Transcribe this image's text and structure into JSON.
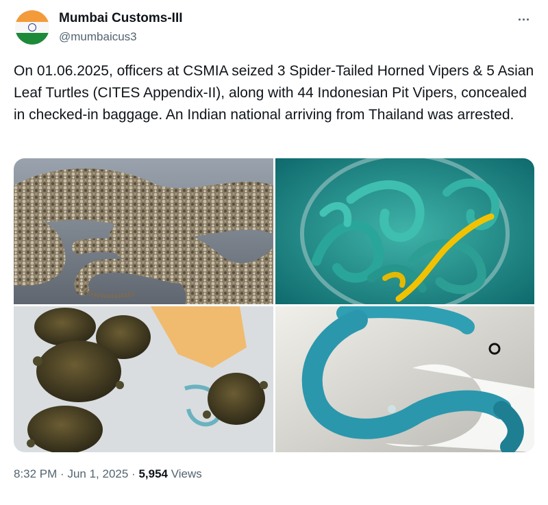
{
  "author": {
    "name": "Mumbai Customs-III",
    "handle": "@mumbaicus3",
    "avatar_icon": "india-flag-avatar"
  },
  "menu": {
    "icon": "more-options-icon"
  },
  "tweet": {
    "text": "On 01.06.2025, officers at CSMIA seized 3 Spider-Tailed Horned Vipers & 5 Asian Leaf Turtles (CITES Appendix-II), along with 44 Indonesian Pit Vipers, concealed in checked-in baggage. An Indian national arriving from Thailand was arrested."
  },
  "media": {
    "count": 4,
    "images": [
      {
        "subject": "spider-tailed horned viper"
      },
      {
        "subject": "pit vipers in container"
      },
      {
        "subject": "asian leaf turtles"
      },
      {
        "subject": "blue pit viper"
      }
    ]
  },
  "footer": {
    "time": "8:32 PM",
    "separator": "·",
    "date": "Jun 1, 2025",
    "views_count": "5,954",
    "views_label": "Views"
  },
  "colors": {
    "text_primary": "#0f1419",
    "text_secondary": "#536471",
    "background": "#ffffff"
  }
}
